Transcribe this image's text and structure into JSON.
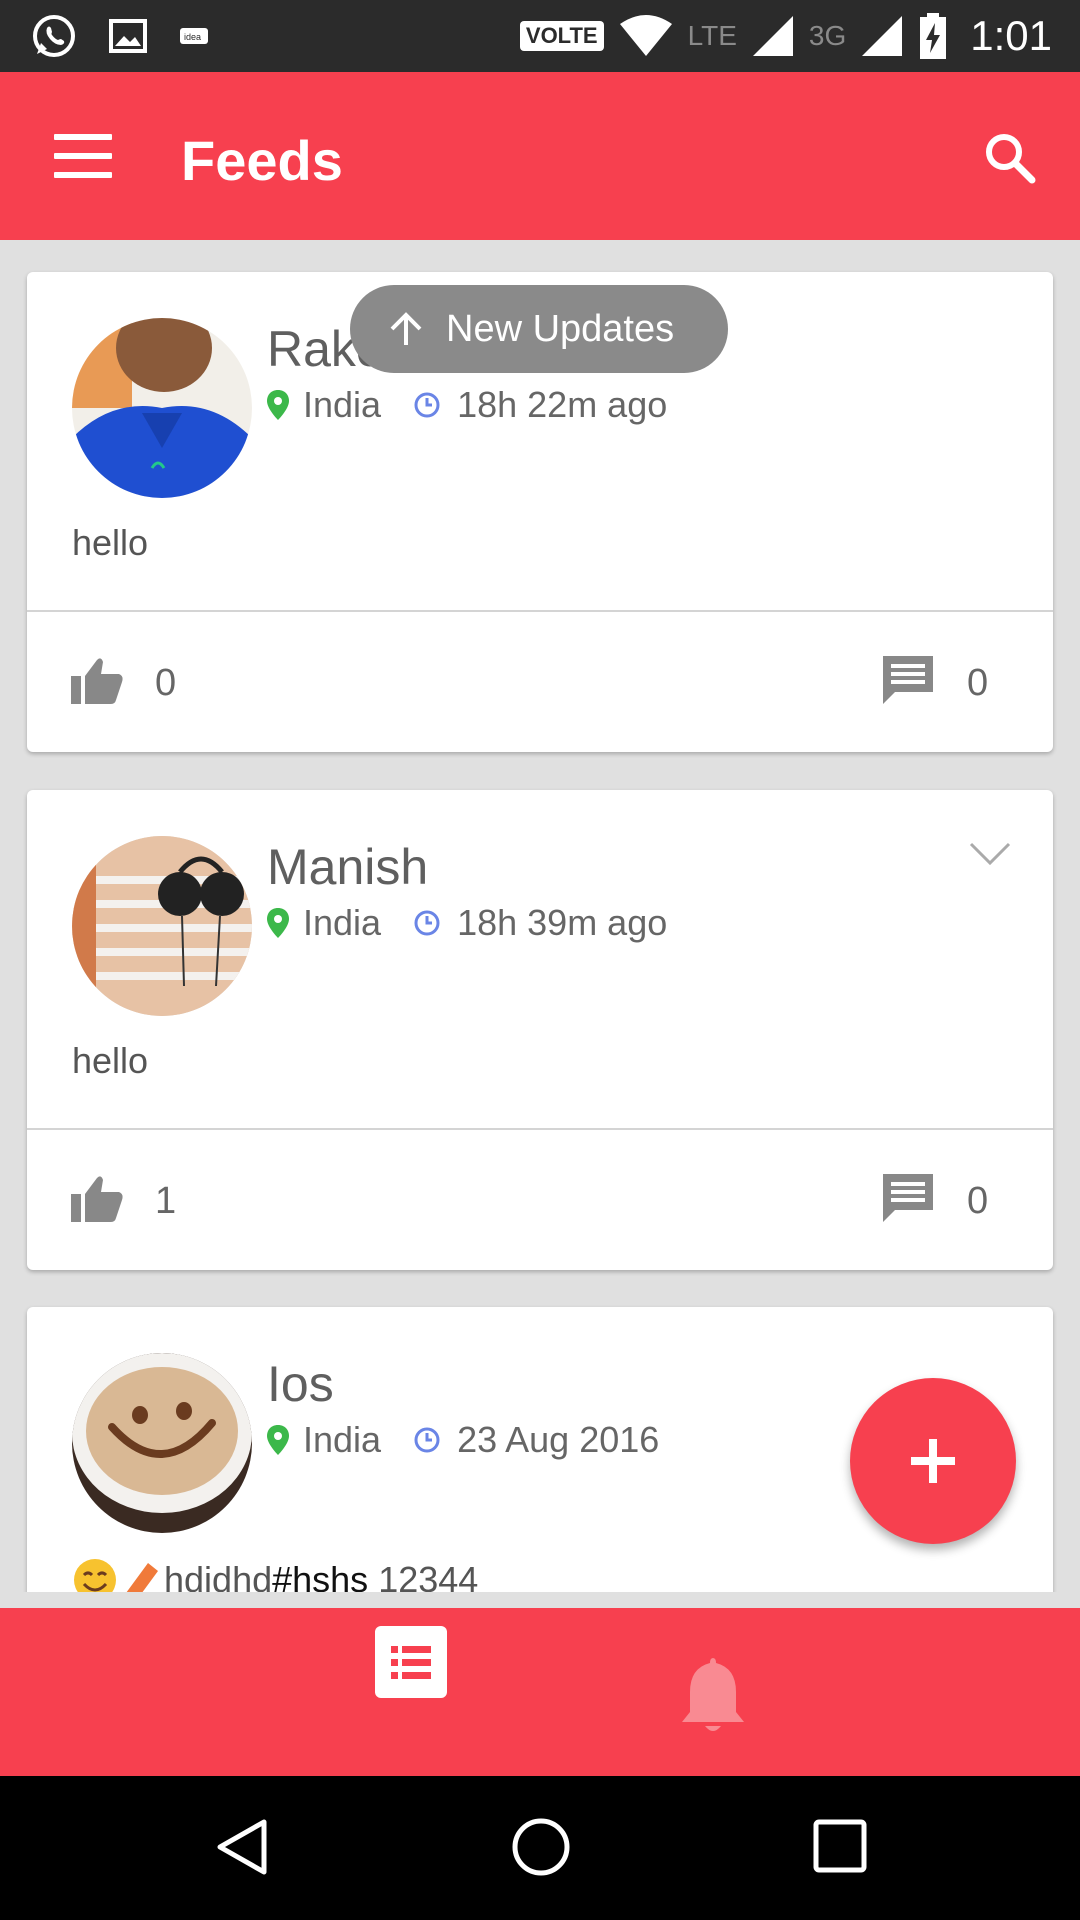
{
  "status_bar": {
    "time": "1:01",
    "volte": "VOLTE",
    "lte": "LTE",
    "net3g": "3G"
  },
  "app_bar": {
    "title": "Feeds"
  },
  "new_updates": {
    "label": "New Updates"
  },
  "posts": [
    {
      "name": "Rake",
      "location": "India",
      "time_ago": "18h 22m ago",
      "text": "hello",
      "likes": "0",
      "comments": "0"
    },
    {
      "name": "Manish",
      "location": "India",
      "time_ago": "18h 39m ago",
      "text": "hello",
      "likes": "1",
      "comments": "0"
    },
    {
      "name": "Ios",
      "location": "India",
      "time_ago": "23 Aug 2016",
      "text_plain": "hdjdhd",
      "text_tag": "#hshs",
      "text_tail": " 12344"
    }
  ],
  "colors": {
    "accent": "#f7404f",
    "status_bar": "#2b2b2b",
    "location_pin": "#3cb84a",
    "clock": "#6a85e6"
  }
}
